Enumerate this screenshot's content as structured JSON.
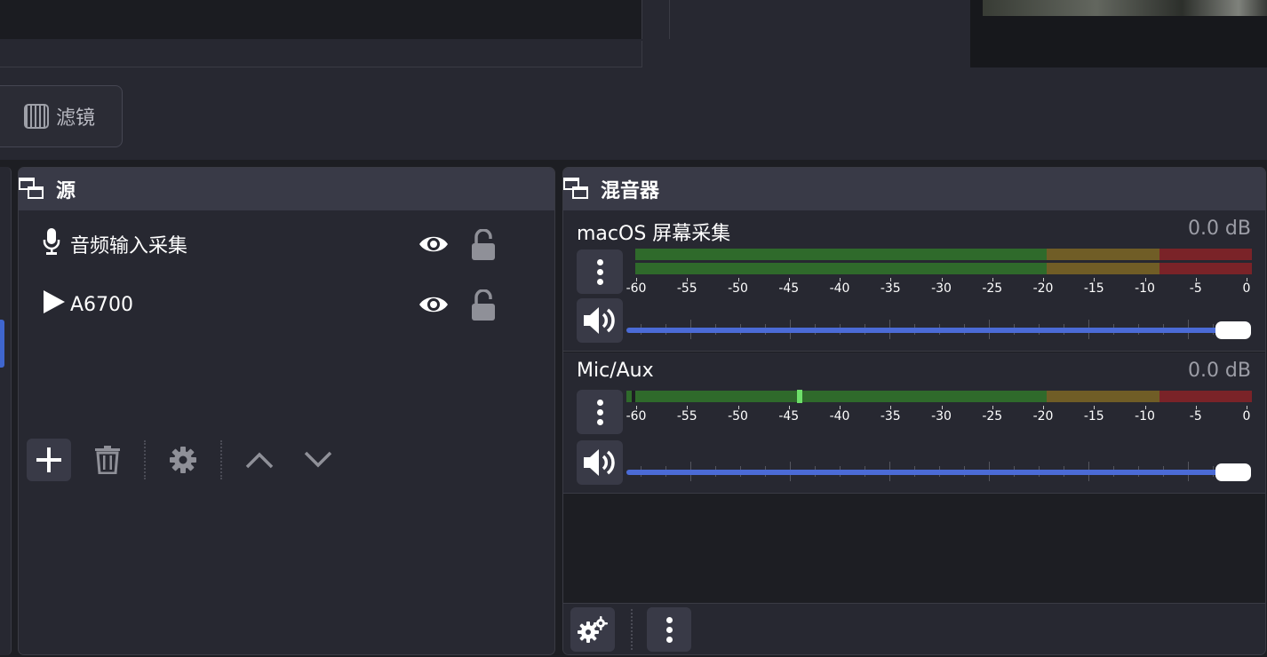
{
  "filters": {
    "label": "滤镜"
  },
  "sources": {
    "title": "源",
    "items": [
      {
        "label": "音频输入采集",
        "type_icon": "microphone-icon"
      },
      {
        "label": "A6700",
        "type_icon": "play-icon"
      }
    ],
    "toolbar": [
      "add-icon",
      "trash-icon",
      "gear-icon",
      "chevron-up-icon",
      "chevron-down-icon"
    ]
  },
  "mixer": {
    "title": "混音器",
    "ticks": [
      "-60",
      "-55",
      "-50",
      "-45",
      "-40",
      "-35",
      "-30",
      "-25",
      "-20",
      "-15",
      "-10",
      "-5",
      "0"
    ],
    "channels": [
      {
        "name": "macOS 屏幕采集",
        "db": "0.0 dB",
        "volume": 1.0
      },
      {
        "name": "Mic/Aux",
        "db": "0.0 dB",
        "volume": 1.0,
        "peak_db": -44
      }
    ],
    "toolbar": [
      "gears-icon",
      "menu-dots-icon"
    ]
  },
  "colors": {
    "accent": "#4b6bd6",
    "meter_green": "#2f6a2b",
    "meter_yellow": "#705d26",
    "meter_red": "#7a2328"
  }
}
